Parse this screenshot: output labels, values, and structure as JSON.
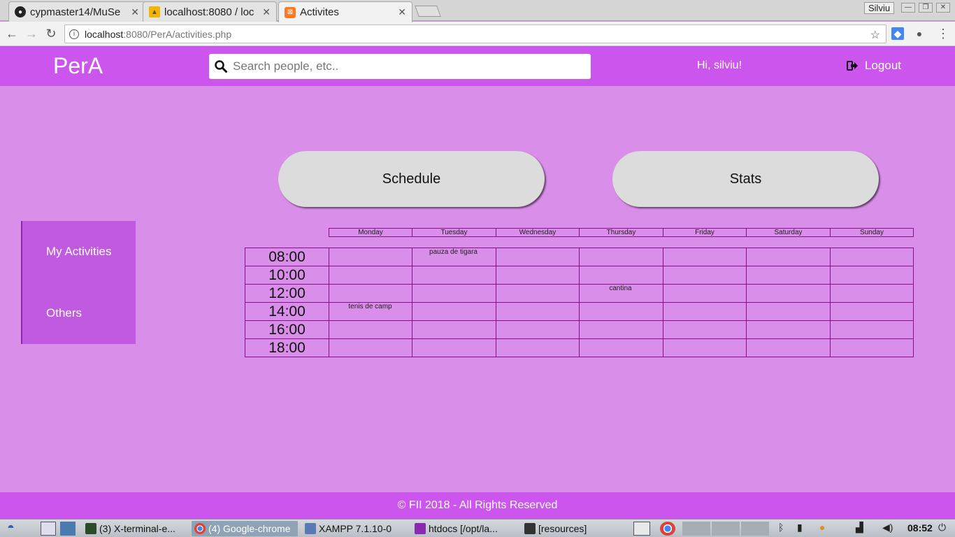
{
  "browser": {
    "tabs": [
      {
        "title": "cypmaster14/MuSe",
        "close": "✕"
      },
      {
        "title": "localhost:8080 / loc",
        "close": "✕"
      },
      {
        "title": "Activites",
        "close": "✕"
      }
    ],
    "profile": "Silviu",
    "url_host": "localhost",
    "url_path": ":8080/PerA/activities.php"
  },
  "header": {
    "logo": "PerA",
    "search_placeholder": "Search people, etc..",
    "greeting": "Hi, silviu!",
    "logout_label": "Logout"
  },
  "buttons": {
    "schedule": "Schedule",
    "stats": "Stats"
  },
  "sidebar": {
    "items": [
      {
        "label": "My Activities"
      },
      {
        "label": "Others"
      }
    ]
  },
  "schedule": {
    "days": [
      "Monday",
      "Tuesday",
      "Wednesday",
      "Thursday",
      "Friday",
      "Saturday",
      "Sunday"
    ],
    "times": [
      "08:00",
      "10:00",
      "12:00",
      "14:00",
      "16:00",
      "18:00"
    ],
    "activities": [
      {
        "day": "Tuesday",
        "time": "08:00",
        "label": "pauza de tigara"
      },
      {
        "day": "Thursday",
        "time": "12:00",
        "label": "cantina"
      },
      {
        "day": "Monday",
        "time": "14:00",
        "label": "tenis de camp"
      }
    ]
  },
  "footer": {
    "copyright": "© FII 2018 - All Rights Reserved"
  },
  "taskbar": {
    "tasks": [
      {
        "label": "(3) X-terminal-e..."
      },
      {
        "label": "(4) Google-chrome"
      },
      {
        "label": "XAMPP 7.1.10-0"
      },
      {
        "label": "htdocs [/opt/la..."
      },
      {
        "label": "[resources]"
      }
    ],
    "clock": "08:52"
  }
}
